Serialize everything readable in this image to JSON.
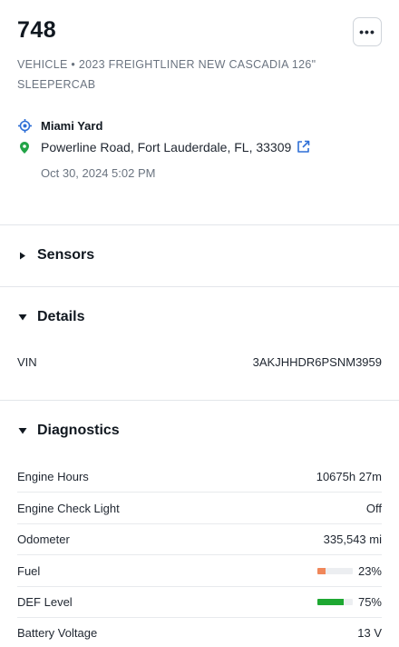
{
  "header": {
    "title": "748",
    "subtitle": "VEHICLE • 2023 FREIGHTLINER NEW CASCADIA 126\" SLEEPERCAB",
    "more_label": "•••"
  },
  "location": {
    "name": "Miami Yard",
    "address": "Powerline Road, Fort Lauderdale, FL, 33309",
    "timestamp": "Oct 30, 2024 5:02 PM",
    "icons": {
      "place": "geofence-icon",
      "pin": "map-pin-icon",
      "link": "external-link-icon"
    },
    "colors": {
      "place": "#2f6fd6",
      "pin": "#22a447",
      "link": "#2f6fd6"
    }
  },
  "sections": {
    "sensors": {
      "title": "Sensors",
      "expanded": false
    },
    "details": {
      "title": "Details",
      "expanded": true
    },
    "diagnostics": {
      "title": "Diagnostics",
      "expanded": true
    }
  },
  "details": {
    "vin_label": "VIN",
    "vin_value": "3AKJHHDR6PSNM3959"
  },
  "diagnostics": {
    "engine_hours": {
      "label": "Engine Hours",
      "value": "10675h 27m"
    },
    "check_light": {
      "label": "Engine Check Light",
      "value": "Off"
    },
    "odometer": {
      "label": "Odometer",
      "value": "335,543 mi"
    },
    "fuel": {
      "label": "Fuel",
      "value": "23%",
      "level": 0.23,
      "color": "#f0875a"
    },
    "def_level": {
      "label": "DEF Level",
      "value": "75%",
      "level": 0.75,
      "color": "#1ea832"
    },
    "battery": {
      "label": "Battery Voltage",
      "value": "13 V"
    }
  }
}
